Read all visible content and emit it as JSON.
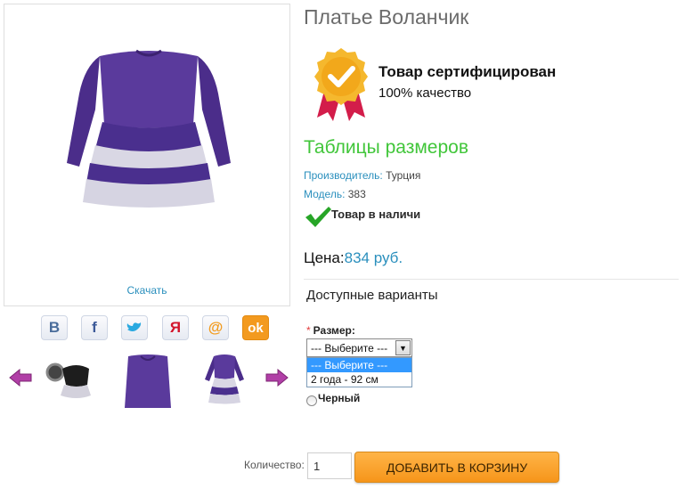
{
  "product": {
    "title": "Платье Воланчик",
    "download_label": "Скачать"
  },
  "certificate": {
    "title": "Товар сертифицирован",
    "subtitle": "100% качество",
    "badge_colors": {
      "gold": "#f5b82e",
      "ribbon": "#d31d4a"
    }
  },
  "size_tables_link": "Таблицы размеров",
  "meta": {
    "maker_key": "Производитель:",
    "maker_value": "Турция",
    "model_key": "Модель:",
    "model_value": "383"
  },
  "stock": {
    "text": "Товар в наличи"
  },
  "price": {
    "label": "Цена:",
    "value": "834 руб."
  },
  "options": {
    "title": "Доступные варианты",
    "size": {
      "required_mark": "*",
      "label": "Размер:",
      "selected": "--- Выберите ---",
      "options": [
        "--- Выберите ---",
        "2 года - 92 см"
      ]
    },
    "color": {
      "label": "Черный"
    }
  },
  "social": [
    {
      "name": "vk-icon",
      "glyph": "B"
    },
    {
      "name": "facebook-icon",
      "glyph": "f"
    },
    {
      "name": "twitter-icon",
      "glyph": "t"
    },
    {
      "name": "yandex-icon",
      "glyph": "Я"
    },
    {
      "name": "mail-icon",
      "glyph": "@"
    },
    {
      "name": "odnoklassniki-icon",
      "glyph": "ok"
    }
  ],
  "cart": {
    "qty_label": "Количество:",
    "qty_value": "1",
    "add_button": "ДОБАВИТЬ В КОРЗИНУ"
  },
  "colors": {
    "link": "#2a8fbd",
    "accent_green": "#41c63a",
    "dress_purple": "#5a3a9c",
    "cart_orange": "#f6951a",
    "arrow_magenta": "#b13fa7"
  }
}
